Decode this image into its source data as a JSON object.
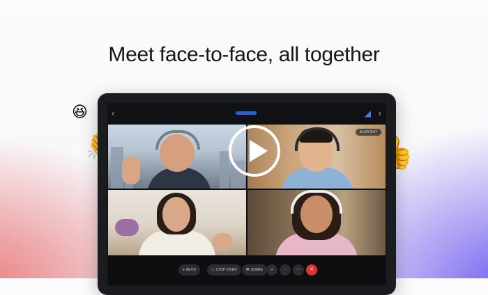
{
  "headline": "Meet face-to-face, all together",
  "colors": {
    "accent": "#3b82f6",
    "end_call": "#e4332c",
    "device_frame": "#1b1c1f",
    "toolbar_bg": "#0d0e10"
  },
  "emoji": {
    "laugh": "😆",
    "clap": "👏",
    "thumbs": "👍"
  },
  "device": {
    "back_icon": "‹",
    "forward_icon": "›",
    "network_icon": "◢",
    "layout_chip": "⊞ LAYOUT",
    "play_icon": "play-icon"
  },
  "toolbar": {
    "mute": "MUTE",
    "stop_video": "STOP VIDEO",
    "share": "SHARE"
  },
  "icons": {
    "mute": "mic-icon",
    "video": "video-icon",
    "share": "share-icon",
    "participants": "participants-icon",
    "chat": "chat-icon",
    "more": "more-icon",
    "end": "end-call-icon"
  }
}
